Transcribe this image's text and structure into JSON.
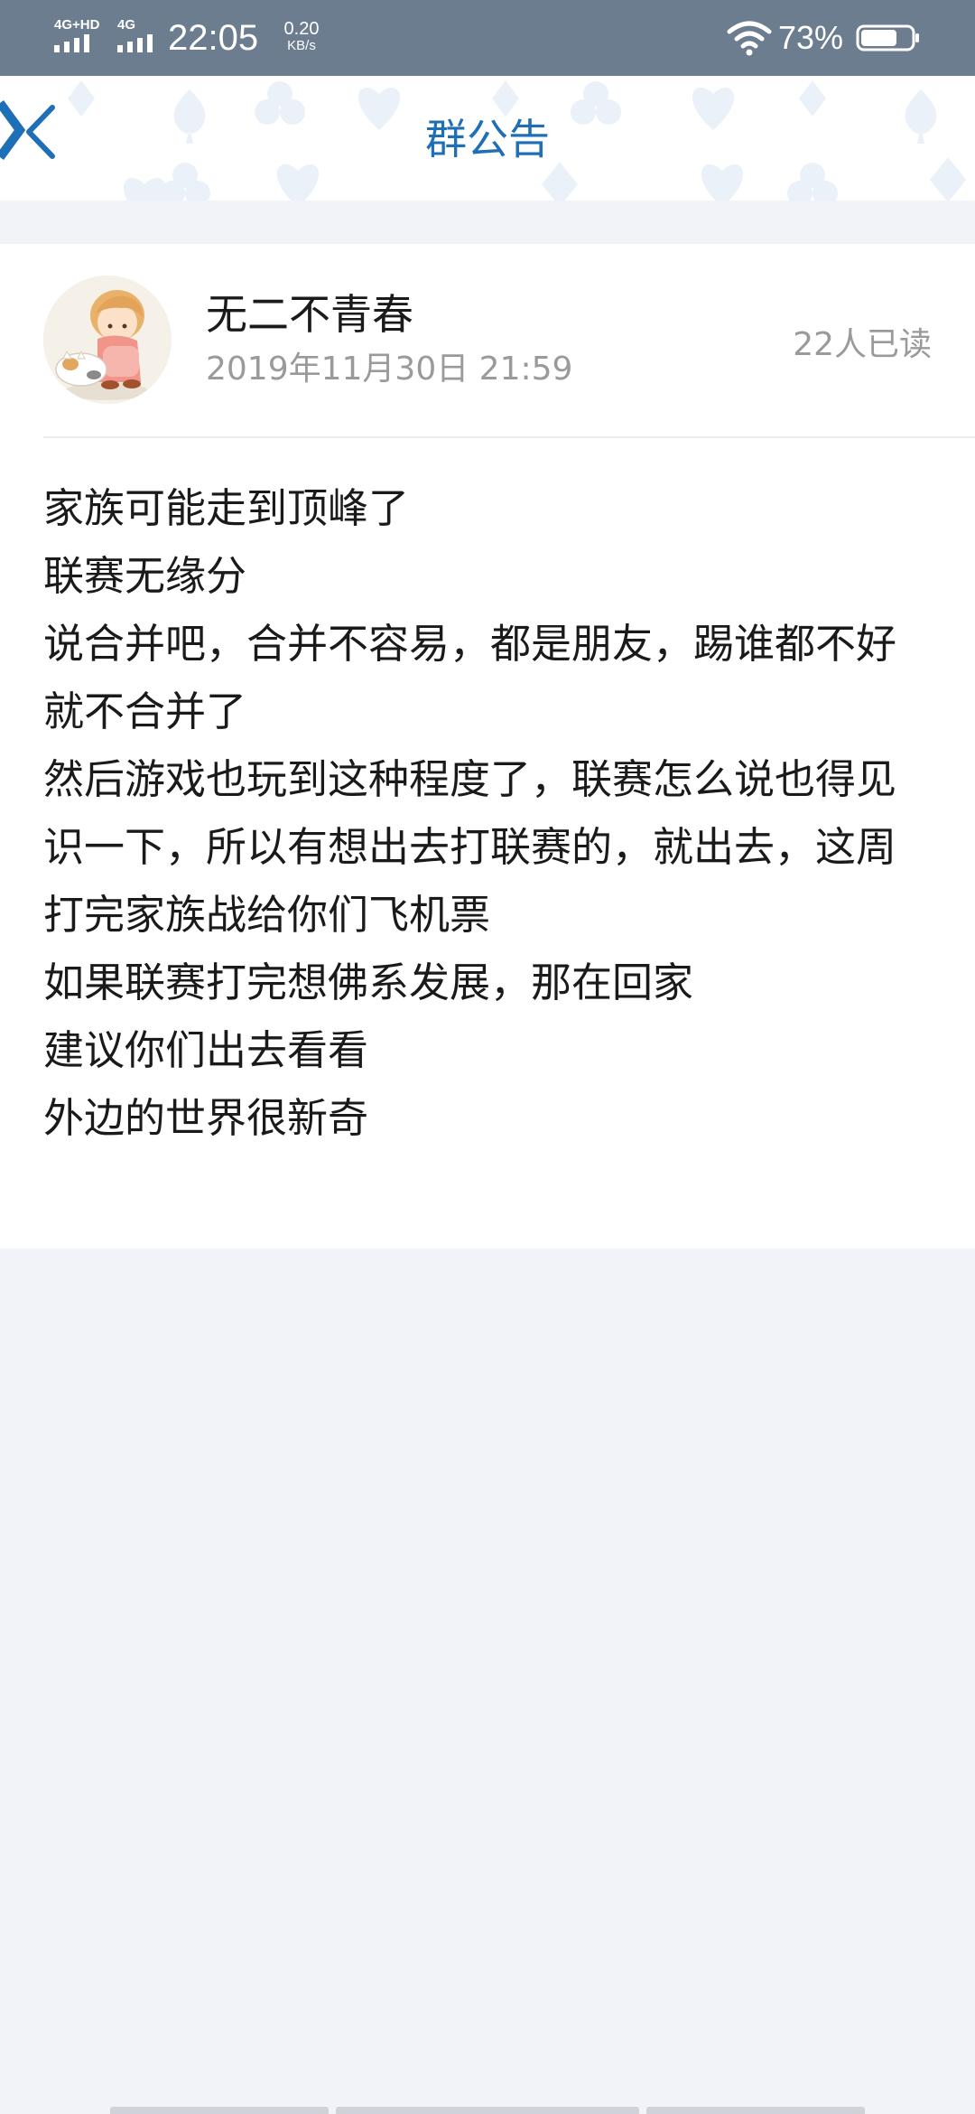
{
  "status_bar": {
    "network_left": "4G+HD",
    "network_right": "4G",
    "time": "22:05",
    "net_speed_value": "0.20",
    "net_speed_unit": "KB/s",
    "battery_percent": "73%",
    "battery_level": 0.73
  },
  "header": {
    "title": "群公告",
    "accent_color": "#1e6fb5"
  },
  "announcement": {
    "author": "无二不青春",
    "date": "2019年11月30日 21:59",
    "read_count": "22人已读",
    "lines": [
      "家族可能走到顶峰了",
      "联赛无缘分",
      "说合并吧，合并不容易，都是朋友，踢谁都不好",
      "就不合并了",
      "然后游戏也玩到这种程度了，联赛怎么说也得见识一下，所以有想出去打联赛的，就出去，这周打完家族战给你们飞机票",
      "如果联赛打完想佛系发展，那在回家",
      "建议你们出去看看",
      "外边的世界很新奇"
    ]
  }
}
